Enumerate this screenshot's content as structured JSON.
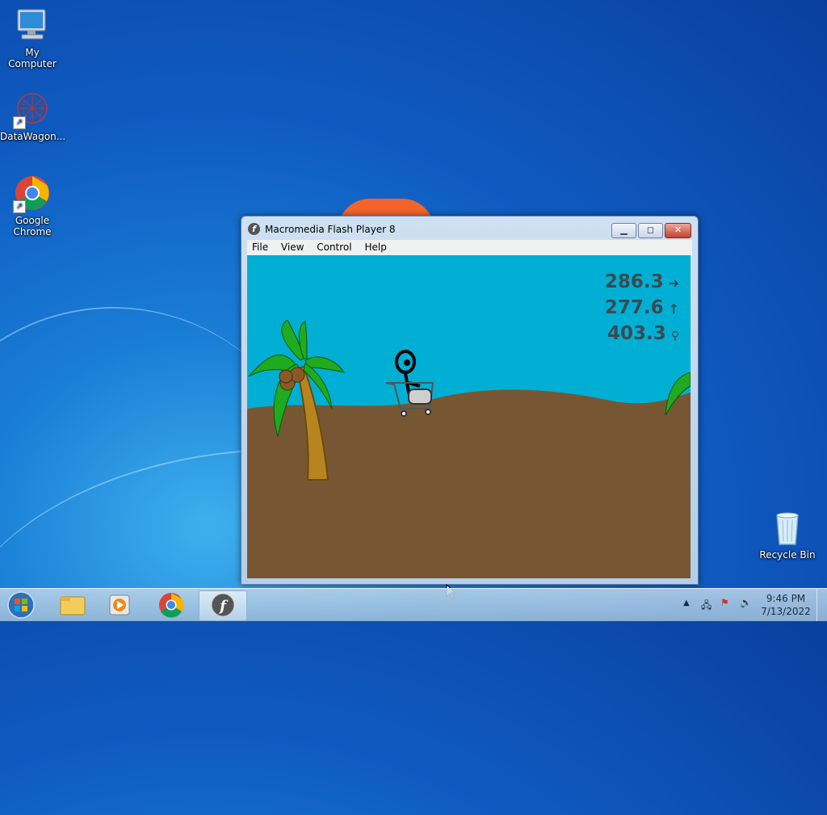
{
  "desktop": {
    "icons": [
      {
        "label": "My Computer",
        "icon": "computer-icon"
      },
      {
        "label": "DataWagon...",
        "icon": "datawagon-icon"
      },
      {
        "label": "Google Chrome",
        "icon": "chrome-icon"
      },
      {
        "label": "Recycle Bin",
        "icon": "recycle-bin-icon"
      }
    ]
  },
  "window": {
    "title": "Macromedia Flash Player 8",
    "menu": [
      "File",
      "View",
      "Control",
      "Help"
    ],
    "controls": {
      "minimize": "minimize-icon",
      "maximize": "maximize-icon",
      "close": "close-icon"
    }
  },
  "game": {
    "stats": [
      {
        "value": "286.3",
        "icon": "arrow-right-icon"
      },
      {
        "value": "277.6",
        "icon": "arrow-up-icon"
      },
      {
        "value": "403.3",
        "icon": "figure-icon"
      }
    ],
    "colors": {
      "sky": "#00afd3",
      "ground": "#775733"
    }
  },
  "taskbar": {
    "buttons": [
      "start-orb",
      "file-explorer-icon",
      "media-player-icon",
      "chrome-icon",
      "flash-player-icon"
    ],
    "clock": {
      "time": "9:46 PM",
      "date": "7/13/2022"
    }
  }
}
